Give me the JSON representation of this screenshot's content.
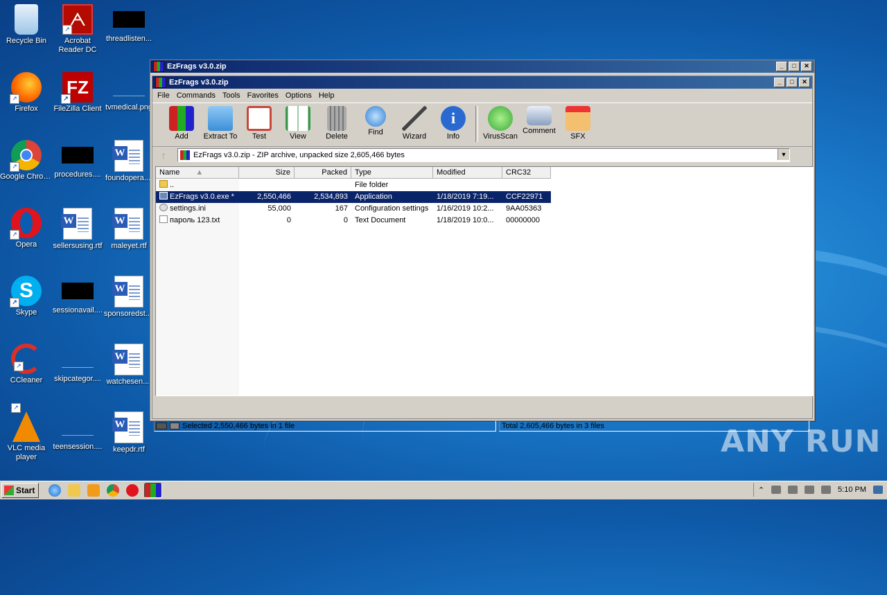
{
  "desktop": {
    "icons": [
      {
        "label": "Recycle Bin",
        "icon": "recycle-bin-icon"
      },
      {
        "label": "Acrobat Reader DC",
        "icon": "acrobat-icon"
      },
      {
        "label": "threadlisten...",
        "icon": "hidden-file-icon"
      },
      {
        "label": "Firefox",
        "icon": "firefox-icon"
      },
      {
        "label": "FileZilla Client",
        "icon": "filezilla-icon"
      },
      {
        "label": "tvmedical.png",
        "icon": "image-file-icon"
      },
      {
        "label": "Google Chrome",
        "icon": "chrome-icon"
      },
      {
        "label": "procedures....",
        "icon": "hidden-file-icon"
      },
      {
        "label": "foundopera....",
        "icon": "word-doc-icon"
      },
      {
        "label": "Opera",
        "icon": "opera-icon"
      },
      {
        "label": "sellersusing.rtf",
        "icon": "word-doc-icon"
      },
      {
        "label": "maleyet.rtf",
        "icon": "word-doc-icon"
      },
      {
        "label": "Skype",
        "icon": "skype-icon"
      },
      {
        "label": "sessionavail....",
        "icon": "hidden-file-icon"
      },
      {
        "label": "sponsoredst....",
        "icon": "word-doc-icon"
      },
      {
        "label": "CCleaner",
        "icon": "ccleaner-icon"
      },
      {
        "label": "skipcategor....",
        "icon": "blank-file-icon"
      },
      {
        "label": "watchesen....",
        "icon": "word-doc-icon"
      },
      {
        "label": "VLC media player",
        "icon": "vlc-icon"
      },
      {
        "label": "teensession....",
        "icon": "blank-file-icon"
      },
      {
        "label": "keepdr.rtf",
        "icon": "word-doc-icon"
      }
    ]
  },
  "window": {
    "outer_title": "EzFrags v3.0.zip",
    "inner_title": "EzFrags v3.0.zip",
    "menu": [
      "File",
      "Commands",
      "Tools",
      "Favorites",
      "Options",
      "Help"
    ],
    "toolbar": [
      {
        "label": "Add",
        "icon": "add-archive-icon",
        "color": "#c83a2a"
      },
      {
        "label": "Extract To",
        "icon": "extract-folder-icon",
        "color": "#3b8fd8"
      },
      {
        "label": "Test",
        "icon": "test-clipboard-icon",
        "color": "#c8463a"
      },
      {
        "label": "View",
        "icon": "view-book-icon",
        "color": "#3a9a4a"
      },
      {
        "label": "Delete",
        "icon": "trash-icon",
        "color": "#8a8a8a"
      },
      {
        "label": "Find",
        "icon": "magnifier-icon",
        "color": "#2f7fd0"
      },
      {
        "label": "Wizard",
        "icon": "wand-icon",
        "color": "#b0a060"
      },
      {
        "label": "Info",
        "icon": "info-icon",
        "color": "#2a6ad0"
      },
      {
        "label": "VirusScan",
        "icon": "virus-scan-icon",
        "color": "#3aa83a"
      },
      {
        "label": "Comment",
        "icon": "comment-icon",
        "color": "#8aa0c0"
      },
      {
        "label": "SFX",
        "icon": "sfx-box-icon",
        "color": "#e0a040"
      }
    ],
    "address": "EzFrags v3.0.zip - ZIP archive, unpacked size 2,605,466 bytes",
    "columns": [
      "Name",
      "Size",
      "Packed",
      "Type",
      "Modified",
      "CRC32"
    ],
    "rows": [
      {
        "name": "..",
        "size": "",
        "packed": "",
        "type": "File folder",
        "modified": "",
        "crc": "",
        "icon": "folder-icon",
        "selected": false
      },
      {
        "name": "EzFrags v3.0.exe *",
        "size": "2,550,466",
        "packed": "2,534,893",
        "type": "Application",
        "modified": "1/18/2019 7:19...",
        "crc": "CCF22971",
        "icon": "exe-icon",
        "selected": true
      },
      {
        "name": "settings.ini",
        "size": "55,000",
        "packed": "167",
        "type": "Configuration settings",
        "modified": "1/16/2019 10:2...",
        "crc": "9AA05363",
        "icon": "settings-file-icon",
        "selected": false
      },
      {
        "name": "пароль 123.txt",
        "size": "0",
        "packed": "0",
        "type": "Text Document",
        "modified": "1/18/2019 10:0...",
        "crc": "00000000",
        "icon": "text-file-icon",
        "selected": false
      }
    ],
    "status_left": "Selected 2,550,466 bytes in 1 file",
    "status_right": "Total 2,605,466 bytes in 3 files"
  },
  "taskbar": {
    "start_label": "Start",
    "clock": "5:10 PM"
  },
  "watermark": "ANY RUN"
}
